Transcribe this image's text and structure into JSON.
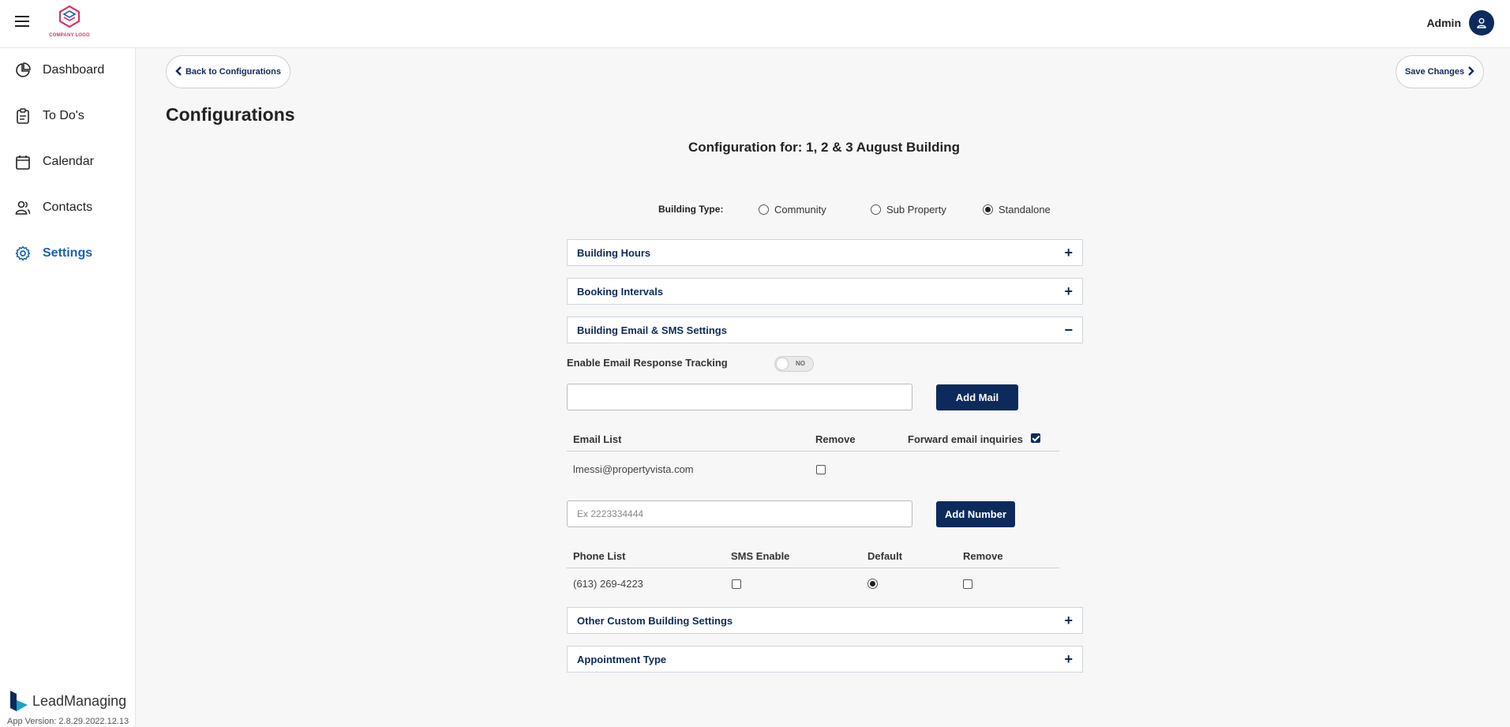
{
  "header": {
    "logo_text": "COMPANY LOGO",
    "user_name": "Admin"
  },
  "sidebar": {
    "items": [
      {
        "label": "Dashboard",
        "icon": "pie-chart-icon",
        "active": false
      },
      {
        "label": "To Do's",
        "icon": "clipboard-icon",
        "active": false
      },
      {
        "label": "Calendar",
        "icon": "calendar-icon",
        "active": false
      },
      {
        "label": "Contacts",
        "icon": "contacts-icon",
        "active": false
      },
      {
        "label": "Settings",
        "icon": "gear-icon",
        "active": true
      }
    ],
    "brand": "LeadManaging",
    "app_version": "App Version: 2.8.29.2022.12.13"
  },
  "toolbar": {
    "back_label": "Back to Configurations",
    "save_label": "Save Changes"
  },
  "page": {
    "title": "Configurations",
    "config_for": "Configuration for: 1, 2 & 3 August Building"
  },
  "building_type": {
    "label": "Building Type:",
    "options": [
      "Community",
      "Sub Property",
      "Standalone"
    ],
    "selected": "Standalone"
  },
  "sections": {
    "building_hours": {
      "title": "Building Hours",
      "sign": "+"
    },
    "booking_intervals": {
      "title": "Booking Intervals",
      "sign": "+"
    },
    "email_sms": {
      "title": "Building Email & SMS Settings",
      "sign": "−"
    },
    "other_custom": {
      "title": "Other Custom Building Settings",
      "sign": "+"
    },
    "appointment_type": {
      "title": "Appointment Type",
      "sign": "+"
    }
  },
  "email_settings": {
    "tracking_label": "Enable Email Response Tracking",
    "tracking_toggle": "NO",
    "email_input_value": "",
    "add_mail_label": "Add Mail",
    "headers": {
      "email_list": "Email List",
      "remove": "Remove",
      "forward": "Forward email inquiries"
    },
    "rows": [
      {
        "email": "lmessi@propertyvista.com",
        "remove": false
      }
    ],
    "forward_checked": true
  },
  "phone_settings": {
    "phone_placeholder": "Ex 2223334444",
    "add_number_label": "Add Number",
    "headers": {
      "phone_list": "Phone List",
      "sms_enable": "SMS Enable",
      "default": "Default",
      "remove": "Remove"
    },
    "rows": [
      {
        "phone": "(613) 269-4223",
        "sms_enable": false,
        "default": true,
        "remove": false
      }
    ]
  },
  "colors": {
    "primary": "#0d2a5c",
    "active_nav": "#1a5fb4",
    "logo_accent": "#d6336c"
  }
}
